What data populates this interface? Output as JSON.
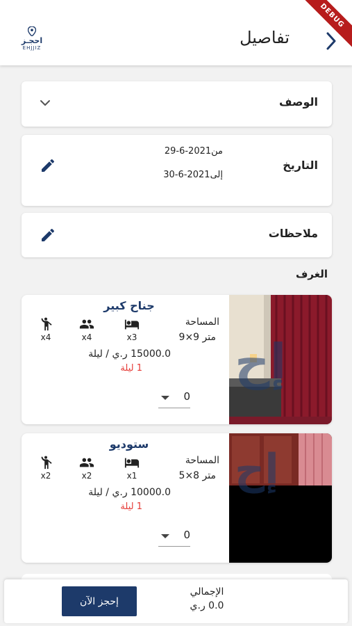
{
  "appbar": {
    "title": "تفاصيل",
    "logo_ar": "احجـز",
    "logo_en": "EHJJIZ",
    "debug_banner": "DEBUG"
  },
  "description": {
    "label": "الوصف"
  },
  "date": {
    "label": "التاريخ",
    "from": "من2021-6-29",
    "to": "إلى2021-6-30"
  },
  "notes": {
    "label": "ملاحظات"
  },
  "rooms_title": "الغرف",
  "rooms": [
    {
      "name": "جناح كبير",
      "area_label": "المساحة",
      "area_value": "9×9 متر",
      "beds": "x3",
      "adults": "x4",
      "children": "x4",
      "price": "15000.0 ر.ي / ليلة",
      "nights": "1 ليلة",
      "quantity": "0"
    },
    {
      "name": "ستوديو",
      "area_label": "المساحة",
      "area_value": "5×8 متر",
      "beds": "x1",
      "adults": "x2",
      "children": "x2",
      "price": "10000.0 ر.ي / ليلة",
      "nights": "1 ليلة",
      "quantity": "0"
    }
  ],
  "footer": {
    "book_now": "إحجز الآن",
    "total_label": "الإجمالي",
    "total_value": "0.0 ر.ي"
  },
  "colors": {
    "primary": "#1d3a6a",
    "accent_red": "#e53935"
  }
}
